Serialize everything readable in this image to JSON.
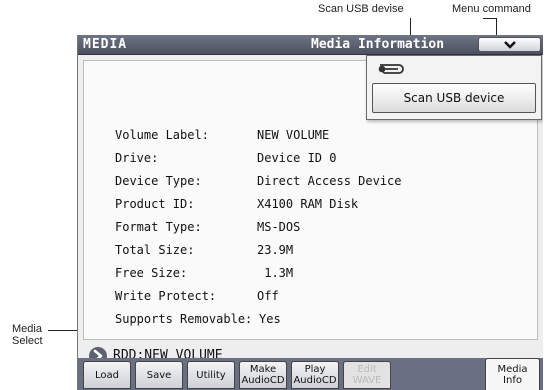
{
  "annotations": {
    "scan_usb": "Scan USB devise",
    "menu_command": "Menu command",
    "media_select_line1": "Media",
    "media_select_line2": "Select"
  },
  "header": {
    "title": "MEDIA",
    "page_name": "Media Information",
    "menu_button_icon": "chevron-down-icon",
    "menu_button_glyph": "⌄"
  },
  "info": [
    {
      "label": "Volume Label:",
      "value": "NEW VOLUME"
    },
    {
      "label": "Drive:",
      "value": "Device ID 0"
    },
    {
      "label": "Device Type:",
      "value": "Direct Access Device"
    },
    {
      "label": "Product ID:",
      "value": "X4100 RAM Disk"
    },
    {
      "label": "Format Type:",
      "value": "MS-DOS"
    },
    {
      "label": "Total Size:",
      "value": "23.9M"
    },
    {
      "label": "Free Size:",
      "value": " 1.3M"
    },
    {
      "label": "Write Protect:",
      "value": "Off"
    },
    {
      "label": "Supports Removable:",
      "value": "Yes"
    }
  ],
  "menu": {
    "icon": "paperclip-icon",
    "scan_label": "Scan USB device"
  },
  "media_select": {
    "icon": "arrow-right-icon",
    "value": "RDD:NEW VOLUME"
  },
  "tabs": [
    {
      "line1": "Load",
      "line2": "",
      "state": "normal"
    },
    {
      "line1": "Save",
      "line2": "",
      "state": "normal"
    },
    {
      "line1": "Utility",
      "line2": "",
      "state": "normal"
    },
    {
      "line1": "Make",
      "line2": "AudioCD",
      "state": "normal"
    },
    {
      "line1": "Play",
      "line2": "AudioCD",
      "state": "normal"
    },
    {
      "line1": "Edit",
      "line2": "WAVE",
      "state": "disabled"
    },
    {
      "line1": "Media",
      "line2": "Info",
      "state": "active"
    }
  ],
  "colors": {
    "titlebar": "#5a5f6e",
    "tabbar": "#6a7082",
    "panel": "#fafafa"
  }
}
